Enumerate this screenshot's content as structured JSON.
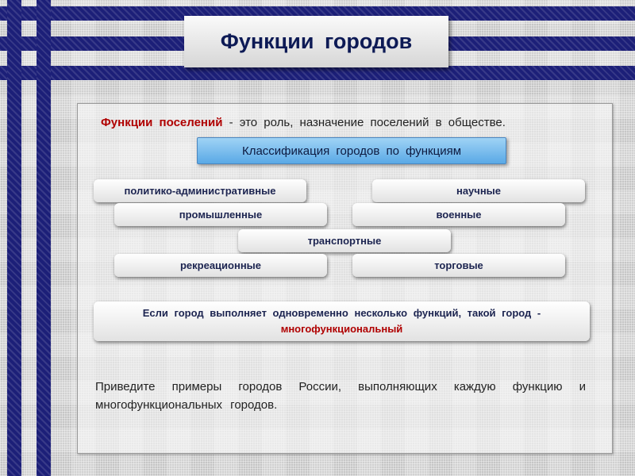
{
  "title": "Функции городов",
  "definition": {
    "term": "Функции поселений",
    "rest": " - это  роль, назначение поселений в обществе."
  },
  "classification_title": "Классификация городов по функциям",
  "functions": [
    "политико-административные",
    "научные",
    "промышленные",
    "военные",
    "транспортные",
    "рекреационные",
    "торговые"
  ],
  "note": {
    "text": "Если город выполняет одновременно несколько функций, такой город -",
    "highlight": "многофункциональный"
  },
  "task": "Приведите примеры городов России, выполняющих каждую функцию и многофункциональных городов.",
  "colors": {
    "stripe": "#1c1f78",
    "title": "#0d1a55",
    "accent_red": "#b00000",
    "classif_blue": "#5aa9e6"
  }
}
